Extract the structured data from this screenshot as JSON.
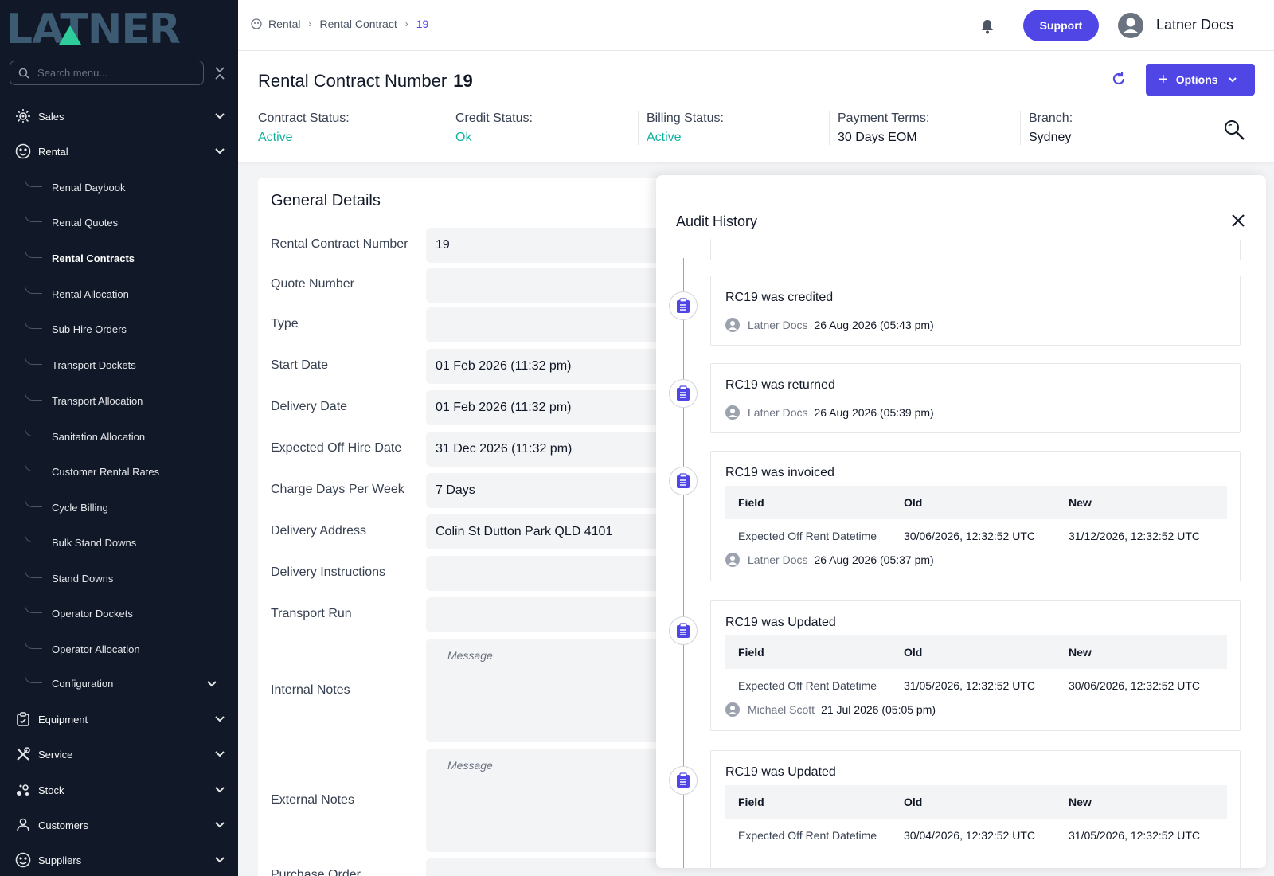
{
  "sidebar": {
    "logo_text": "LATNER",
    "search_placeholder": "Search menu...",
    "items": [
      {
        "label": "Sales"
      },
      {
        "label": "Rental"
      },
      {
        "label": "Equipment"
      },
      {
        "label": "Service"
      },
      {
        "label": "Stock"
      },
      {
        "label": "Customers"
      },
      {
        "label": "Suppliers"
      }
    ],
    "rental_sub": [
      {
        "label": "Rental Daybook"
      },
      {
        "label": "Rental Quotes"
      },
      {
        "label": "Rental Contracts"
      },
      {
        "label": "Rental Allocation"
      },
      {
        "label": "Sub Hire Orders"
      },
      {
        "label": "Transport Dockets"
      },
      {
        "label": "Transport Allocation"
      },
      {
        "label": "Sanitation Allocation"
      },
      {
        "label": "Customer Rental Rates"
      },
      {
        "label": "Cycle Billing"
      },
      {
        "label": "Bulk Stand Downs"
      },
      {
        "label": "Stand Downs"
      },
      {
        "label": "Operator Dockets"
      },
      {
        "label": "Operator Allocation"
      },
      {
        "label": "Configuration"
      }
    ]
  },
  "topbar": {
    "breadcrumb": [
      "Rental",
      "Rental Contract",
      "19"
    ],
    "support_label": "Support",
    "user_name": "Latner Docs"
  },
  "header": {
    "title": "Rental Contract Number",
    "number": "19",
    "options_label": "Options",
    "stats": [
      {
        "label": "Contract Status:",
        "value": "Active"
      },
      {
        "label": "Credit Status:",
        "value": "Ok"
      },
      {
        "label": "Billing Status:",
        "value": "Active"
      },
      {
        "label": "Payment Terms:",
        "value": "30 Days EOM"
      },
      {
        "label": "Branch:",
        "value": "Sydney"
      }
    ]
  },
  "general": {
    "title": "General Details",
    "fields": [
      {
        "label": "Rental Contract Number",
        "value": "19"
      },
      {
        "label": "Quote Number",
        "value": ""
      },
      {
        "label": "Type",
        "value": ""
      },
      {
        "label": "Start Date",
        "value": "01 Feb 2026 (11:32 pm)"
      },
      {
        "label": "Delivery Date",
        "value": "01 Feb 2026 (11:32 pm)"
      },
      {
        "label": "Expected Off Hire Date",
        "value": "31 Dec 2026 (11:32 pm)"
      },
      {
        "label": "Charge Days Per Week",
        "value": "7 Days"
      },
      {
        "label": "Delivery Address",
        "value": "Colin St Dutton Park QLD 4101"
      },
      {
        "label": "Delivery Instructions",
        "value": ""
      },
      {
        "label": "Transport Run",
        "value": ""
      },
      {
        "label": "Internal Notes",
        "placeholder": "Message"
      },
      {
        "label": "External Notes",
        "placeholder": "Message"
      },
      {
        "label": "Purchase Order",
        "value": ""
      }
    ]
  },
  "audit": {
    "title": "Audit History",
    "col_field": "Field",
    "col_old": "Old",
    "col_new": "New",
    "entries": [
      {
        "title": "RC19 was credited",
        "user": "Latner Docs",
        "date": "26 Aug 2026 (05:43 pm)"
      },
      {
        "title": "RC19 was returned",
        "user": "Latner Docs",
        "date": "26 Aug 2026 (05:39 pm)"
      },
      {
        "title": "RC19 was invoiced",
        "user": "Latner Docs",
        "date": "26 Aug 2026 (05:37 pm)",
        "change": {
          "field": "Expected Off Rent Datetime",
          "old": "30/06/2026, 12:32:52 UTC",
          "new": "31/12/2026, 12:32:52 UTC"
        }
      },
      {
        "title": "RC19 was Updated",
        "user": "Michael Scott",
        "date": "21 Jul 2026 (05:05 pm)",
        "change": {
          "field": "Expected Off Rent Datetime",
          "old": "31/05/2026, 12:32:52 UTC",
          "new": "30/06/2026, 12:32:52 UTC"
        }
      },
      {
        "title": "RC19 was Updated",
        "change": {
          "field": "Expected Off Rent Datetime",
          "old": "30/04/2026, 12:32:52 UTC",
          "new": "31/05/2026, 12:32:52 UTC"
        }
      }
    ]
  },
  "colors": {
    "sidebar_bg": "#111827",
    "accent": "#4f46e5",
    "status_green": "#10b1a1"
  },
  "icons": [
    "search-icon",
    "collapse-icon",
    "sales-icon",
    "rental-icon",
    "equipment-icon",
    "service-icon",
    "stock-icon",
    "customers-icon",
    "suppliers-icon",
    "chevron-down-icon",
    "home-icon",
    "bell-icon",
    "user-avatar-icon",
    "refresh-icon",
    "plus-icon",
    "zoom-icon",
    "close-icon",
    "clipboard-icon",
    "user-icon"
  ]
}
